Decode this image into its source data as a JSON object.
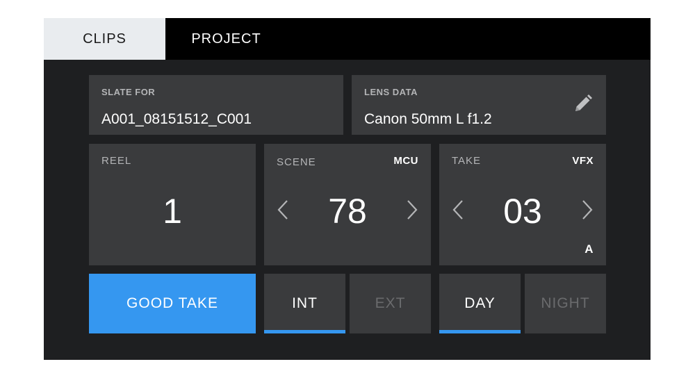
{
  "tabs": [
    {
      "label": "CLIPS",
      "active": true
    },
    {
      "label": "PROJECT",
      "active": false
    }
  ],
  "slate": {
    "label": "SLATE FOR",
    "value": "A001_08151512_C001"
  },
  "lens": {
    "label": "LENS DATA",
    "value": "Canon 50mm L f1.2",
    "edit_icon": "pencil-icon"
  },
  "reel": {
    "label": "REEL",
    "value": "1"
  },
  "scene": {
    "label": "SCENE",
    "value": "78",
    "badge": "MCU"
  },
  "take": {
    "label": "TAKE",
    "value": "03",
    "badge": "VFX",
    "sub_badge": "A"
  },
  "good_take": {
    "label": "GOOD TAKE",
    "active": true
  },
  "int_ext": [
    {
      "label": "INT",
      "selected": true
    },
    {
      "label": "EXT",
      "selected": false
    }
  ],
  "day_night": [
    {
      "label": "DAY",
      "selected": true
    },
    {
      "label": "NIGHT",
      "selected": false
    }
  ],
  "colors": {
    "accent": "#3597f0",
    "background": "#1e1f21",
    "panel": "#3a3b3d",
    "tab_active_bg": "#e9ecef",
    "text_dim": "#6a6b6d"
  }
}
